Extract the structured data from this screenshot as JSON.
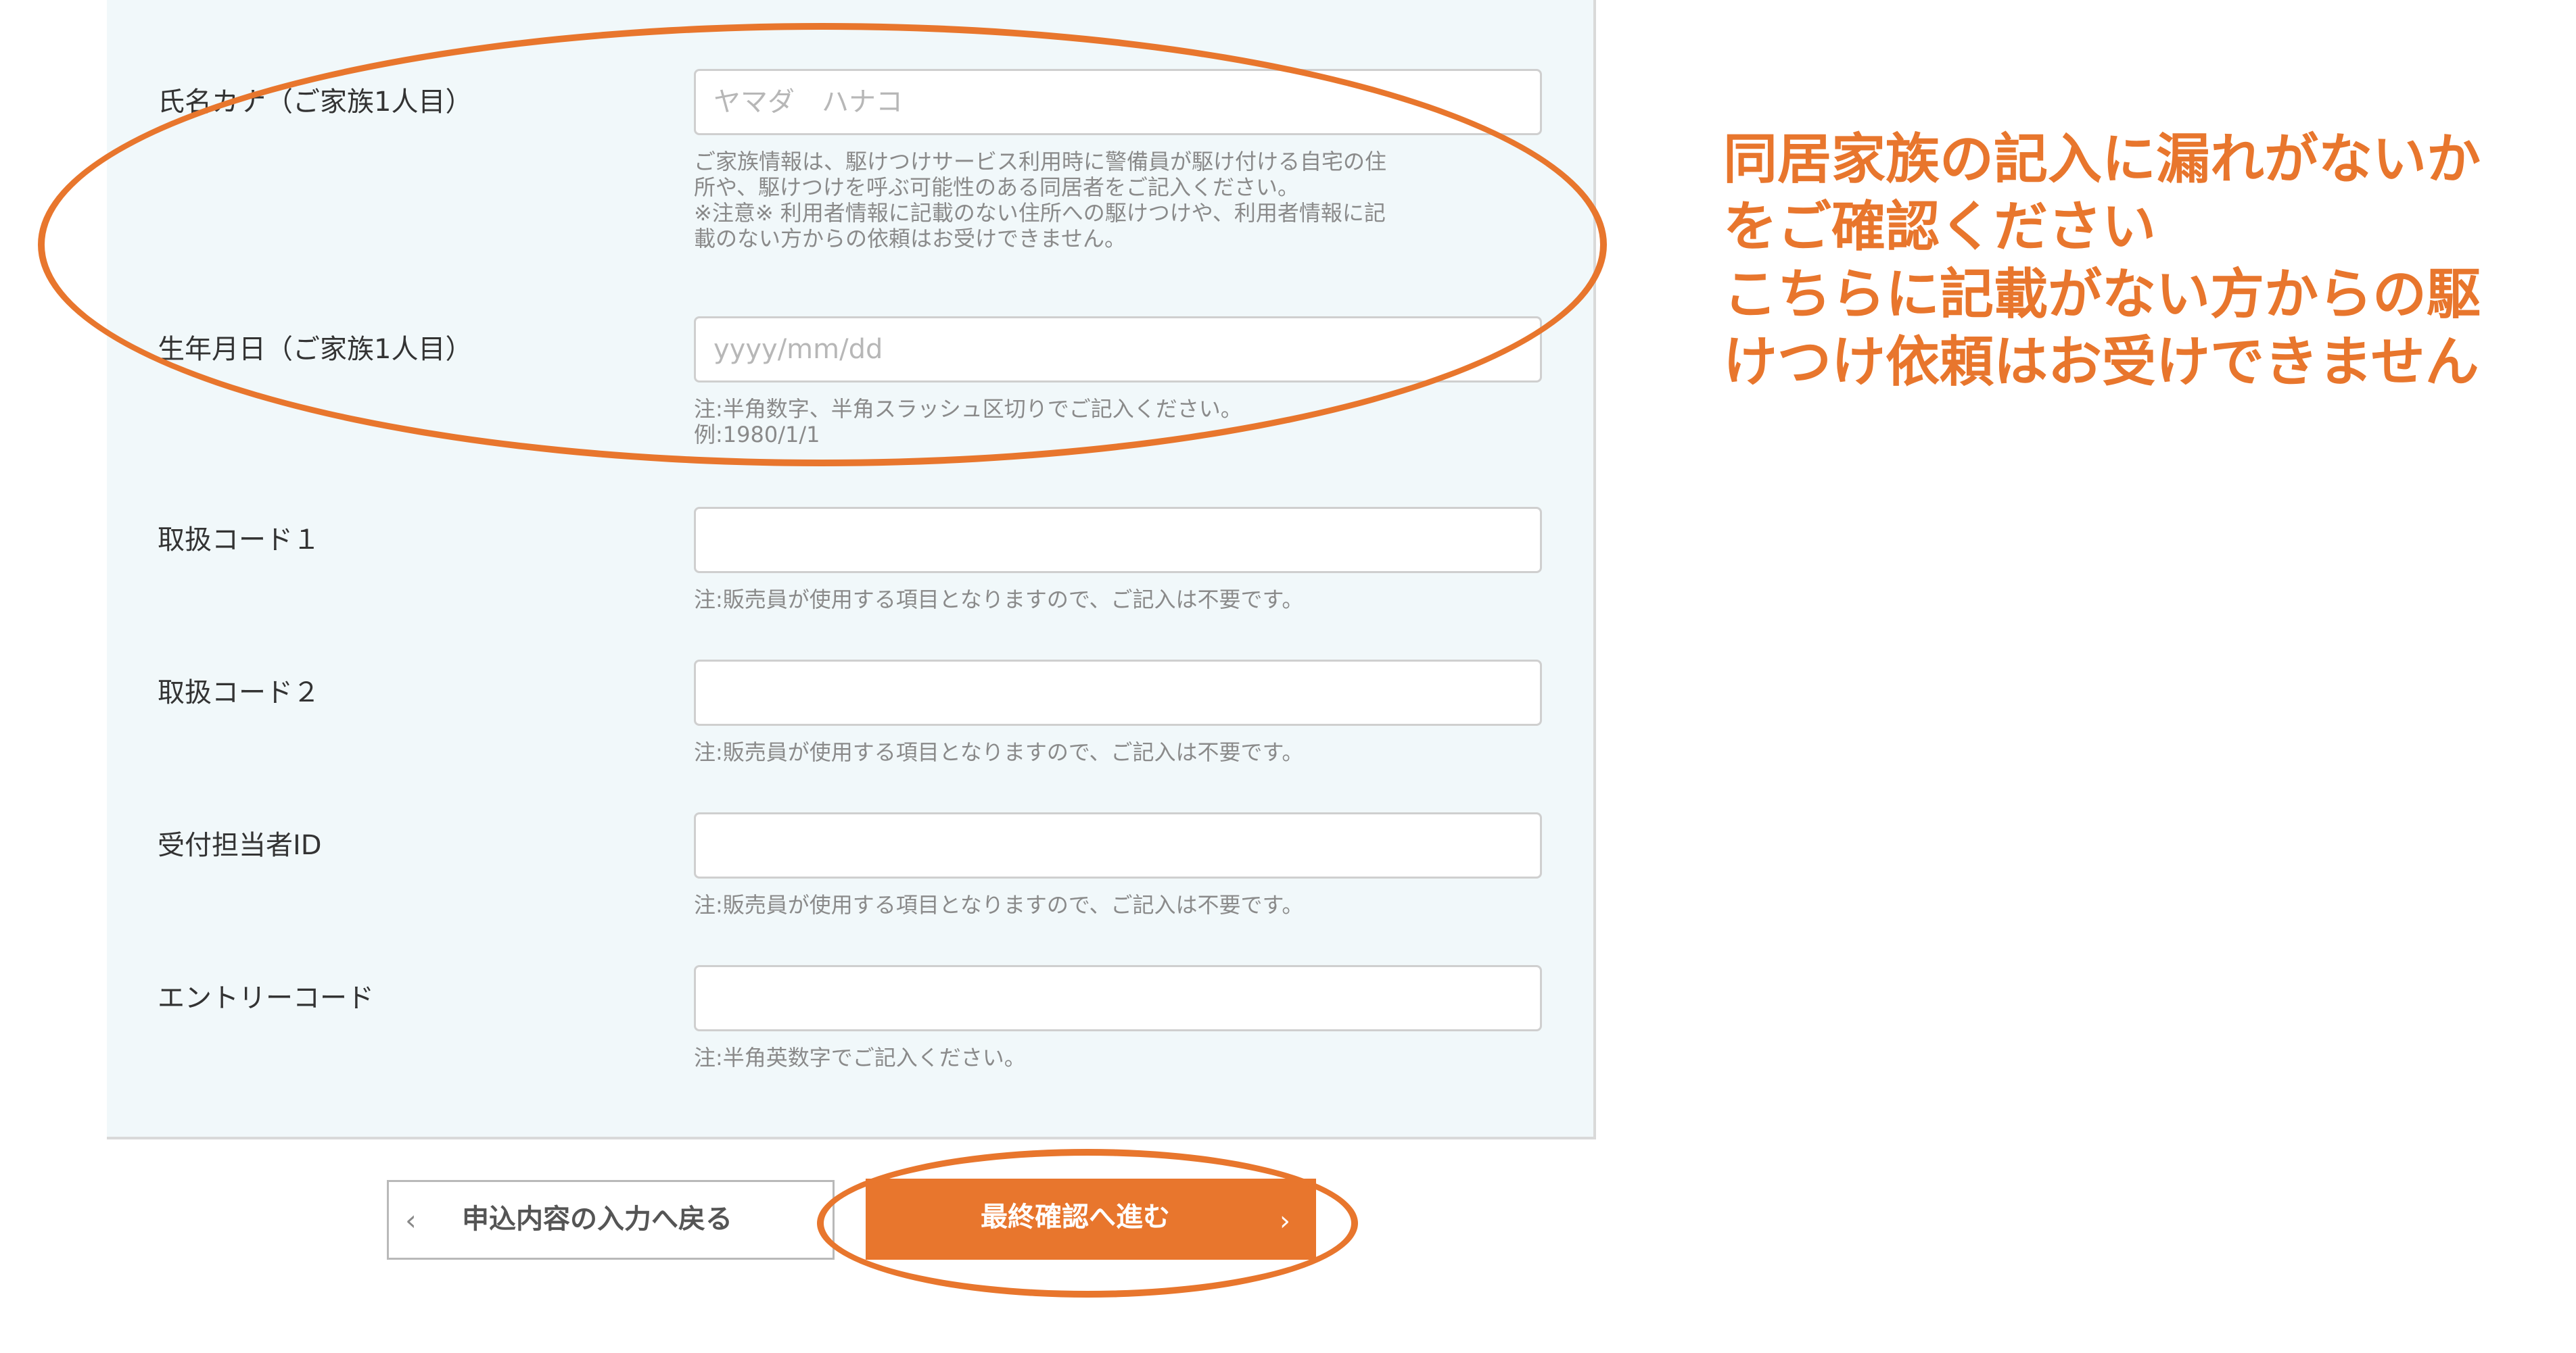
{
  "form": {
    "fields": [
      {
        "label": "氏名カナ（ご家族1人目）",
        "value": "",
        "placeholder": "ヤマダ　ハナコ",
        "notes": [
          "ご家族情報は、駆けつけサービス利用時に警備員が駆け付ける自宅の住",
          "所や、駆けつけを呼ぶ可能性のある同居者をご記入ください。",
          "※注意※ 利用者情報に記載のない住所への駆けつけや、利用者情報に記",
          "載のない方からの依頼はお受けできません。"
        ]
      },
      {
        "label": "生年月日（ご家族1人目）",
        "value": "",
        "placeholder": "yyyy/mm/dd",
        "notes": [
          "注:半角数字、半角スラッシュ区切りでご記入ください。",
          "例:1980/1/1"
        ]
      },
      {
        "label": "取扱コード１",
        "value": "",
        "placeholder": "",
        "notes": [
          "注:販売員が使用する項目となりますので、ご記入は不要です。"
        ]
      },
      {
        "label": "取扱コード２",
        "value": "",
        "placeholder": "",
        "notes": [
          "注:販売員が使用する項目となりますので、ご記入は不要です。"
        ]
      },
      {
        "label": "受付担当者ID",
        "value": "",
        "placeholder": "",
        "notes": [
          "注:販売員が使用する項目となりますので、ご記入は不要です。"
        ]
      },
      {
        "label": "エントリーコード",
        "value": "",
        "placeholder": "",
        "notes": [
          "注:半角英数字でご記入ください。"
        ]
      }
    ]
  },
  "buttons": {
    "back_label": "申込内容の入力へ戻る",
    "back_icon": "chevron-left-icon",
    "next_label": "最終確認へ進む",
    "next_icon": "chevron-right-icon"
  },
  "annotation": {
    "lines": [
      "同居家族の記入に漏れがないか",
      "をご確認ください",
      "こちらに記載がない方からの駆",
      "けつけ依頼はお受けできません"
    ]
  },
  "colors": {
    "accent": "#e8762d",
    "panel_background": "#f1f8fa",
    "note_text": "#8a8a8a"
  }
}
